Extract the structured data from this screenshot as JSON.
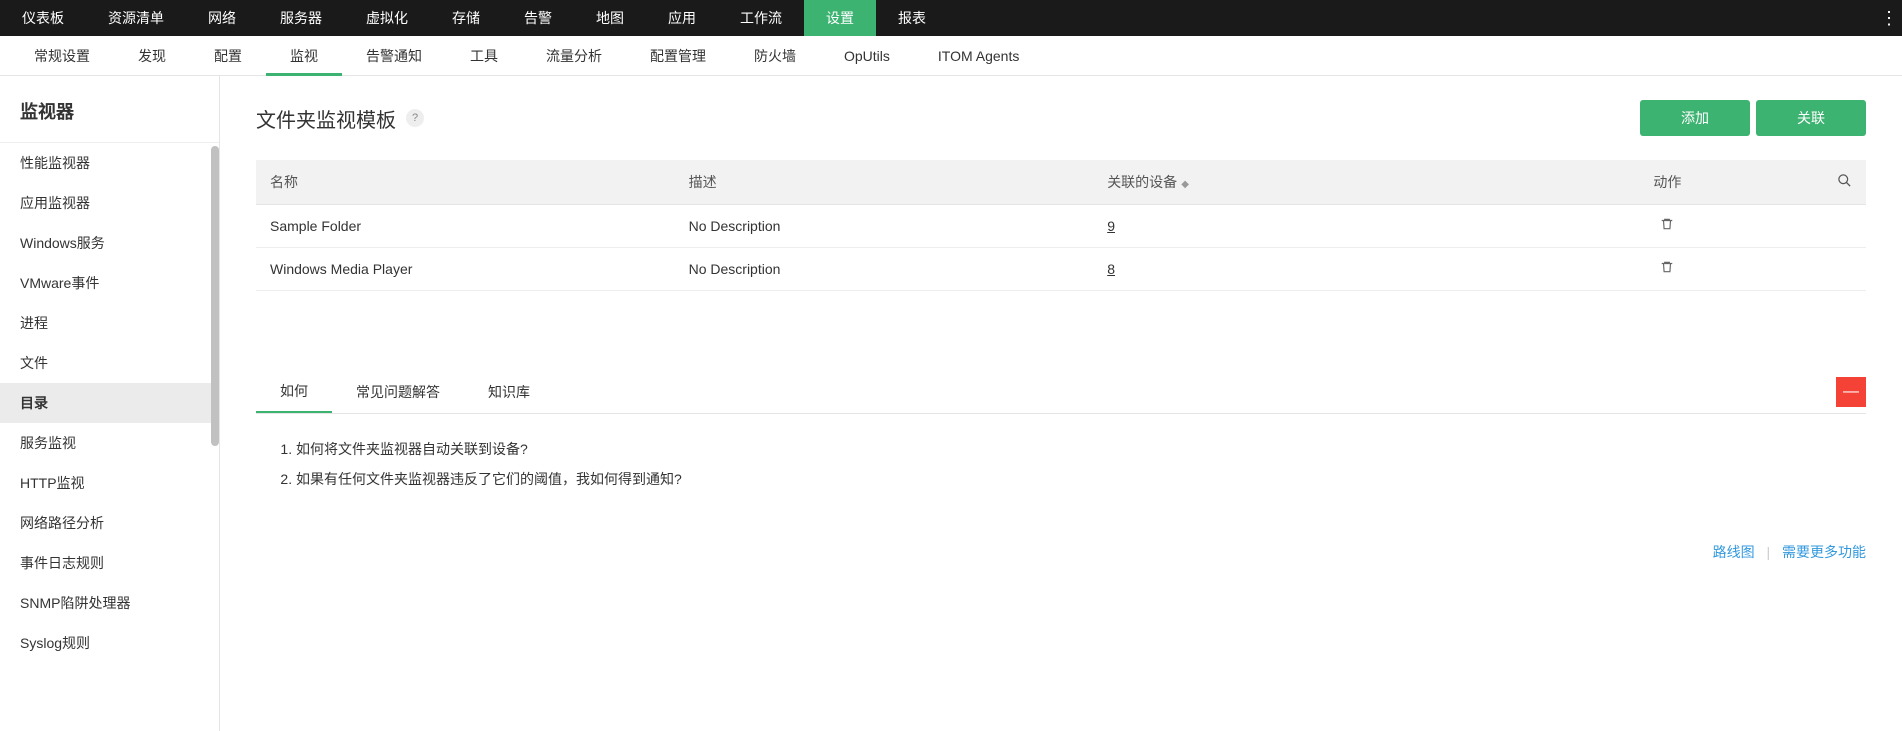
{
  "topNav": {
    "items": [
      "仪表板",
      "资源清单",
      "网络",
      "服务器",
      "虚拟化",
      "存储",
      "告警",
      "地图",
      "应用",
      "工作流",
      "设置",
      "报表"
    ],
    "activeIndex": 10
  },
  "subNav": {
    "items": [
      "常规设置",
      "发现",
      "配置",
      "监视",
      "告警通知",
      "工具",
      "流量分析",
      "配置管理",
      "防火墙",
      "OpUtils",
      "ITOM Agents"
    ],
    "activeIndex": 3
  },
  "sidebar": {
    "title": "监视器",
    "items": [
      "性能监视器",
      "应用监视器",
      "Windows服务",
      "VMware事件",
      "进程",
      "文件",
      "目录",
      "服务监视",
      "HTTP监视",
      "网络路径分析",
      "事件日志规则",
      "SNMP陷阱处理器",
      "Syslog规则"
    ],
    "activeIndex": 6
  },
  "page": {
    "title": "文件夹监视模板",
    "addBtn": "添加",
    "assocBtn": "关联"
  },
  "table": {
    "headers": {
      "name": "名称",
      "desc": "描述",
      "devices": "关联的设备",
      "action": "动作"
    },
    "rows": [
      {
        "name": "Sample Folder",
        "desc": "No Description",
        "devices": "9"
      },
      {
        "name": "Windows Media Player",
        "desc": "No Description",
        "devices": "8"
      }
    ]
  },
  "help": {
    "tabs": [
      "如何",
      "常见问题解答",
      "知识库"
    ],
    "activeIndex": 0,
    "questions": [
      "如何将文件夹监视器自动关联到设备?",
      "如果有任何文件夹监视器违反了它们的阈值，我如何得到通知?"
    ]
  },
  "footer": {
    "roadmap": "路线图",
    "more": "需要更多功能"
  }
}
